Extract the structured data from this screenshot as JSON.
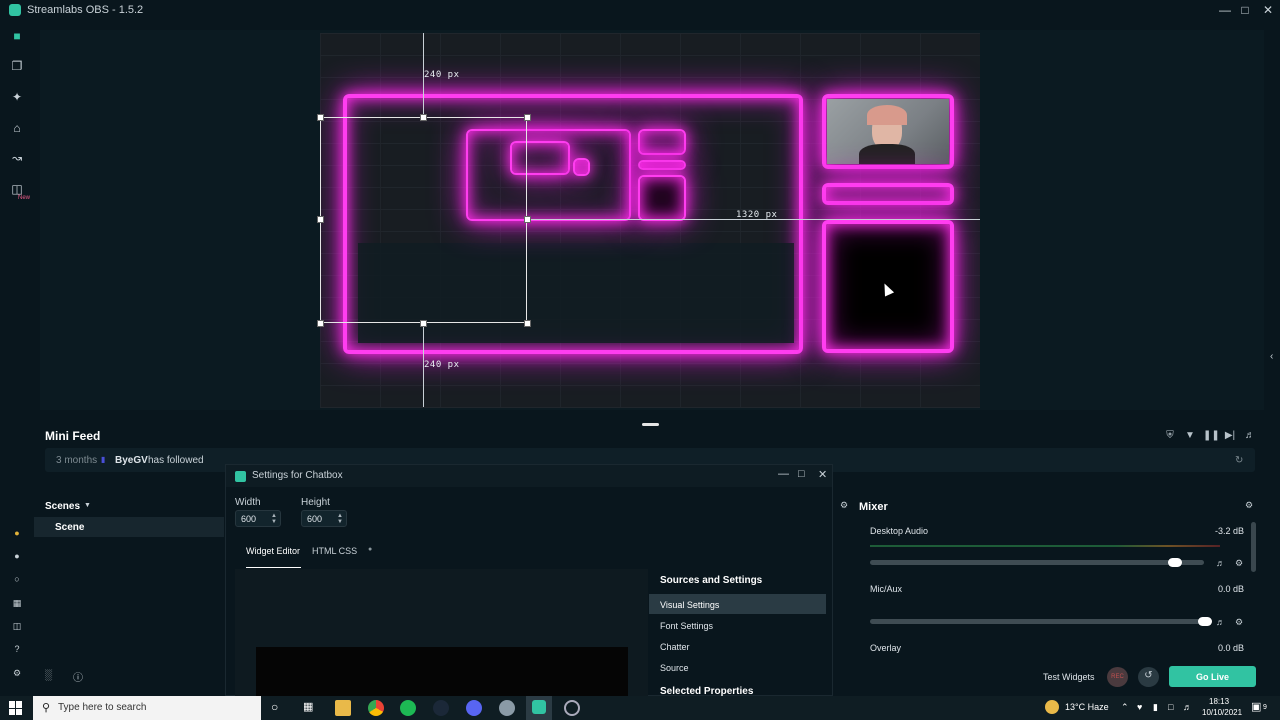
{
  "window": {
    "title": "Streamlabs OBS - 1.5.2"
  },
  "preview": {
    "labels": {
      "top": "240 px",
      "bottom": "240 px",
      "right": "1320 px"
    }
  },
  "minifeed": {
    "title": "Mini Feed",
    "event": {
      "duration": "3 months",
      "user": "ByeGV",
      "action": "has followed"
    }
  },
  "scenes": {
    "title": "Scenes",
    "items": [
      "Scene"
    ]
  },
  "modal": {
    "title": "Settings for Chatbox",
    "width_label": "Width",
    "width_value": "600",
    "height_label": "Height",
    "height_value": "600",
    "tabs": [
      "Widget Editor",
      "HTML CSS"
    ],
    "sidebar_title": "Sources and Settings",
    "sidebar_items": [
      "Visual Settings",
      "Font Settings",
      "Chatter",
      "Source"
    ],
    "sidebar_next": "Selected Properties"
  },
  "mixer": {
    "title": "Mixer",
    "channels": [
      {
        "name": "Desktop Audio",
        "db": "-3.2 dB",
        "level": 0.9
      },
      {
        "name": "Mic/Aux",
        "db": "0.0 dB",
        "level": 1.0
      },
      {
        "name": "Overlay",
        "db": "0.0 dB"
      }
    ]
  },
  "footer": {
    "test_widgets": "Test Widgets",
    "rec": "REC",
    "go_live": "Go Live"
  },
  "taskbar": {
    "search_placeholder": "Type here to search",
    "weather": "13°C  Haze",
    "time": "18:13",
    "date": "10/10/2021",
    "notifications": "9"
  },
  "colors": {
    "accent": "#31c3a2",
    "neon": "#ff3df0",
    "background": "#09161d"
  }
}
